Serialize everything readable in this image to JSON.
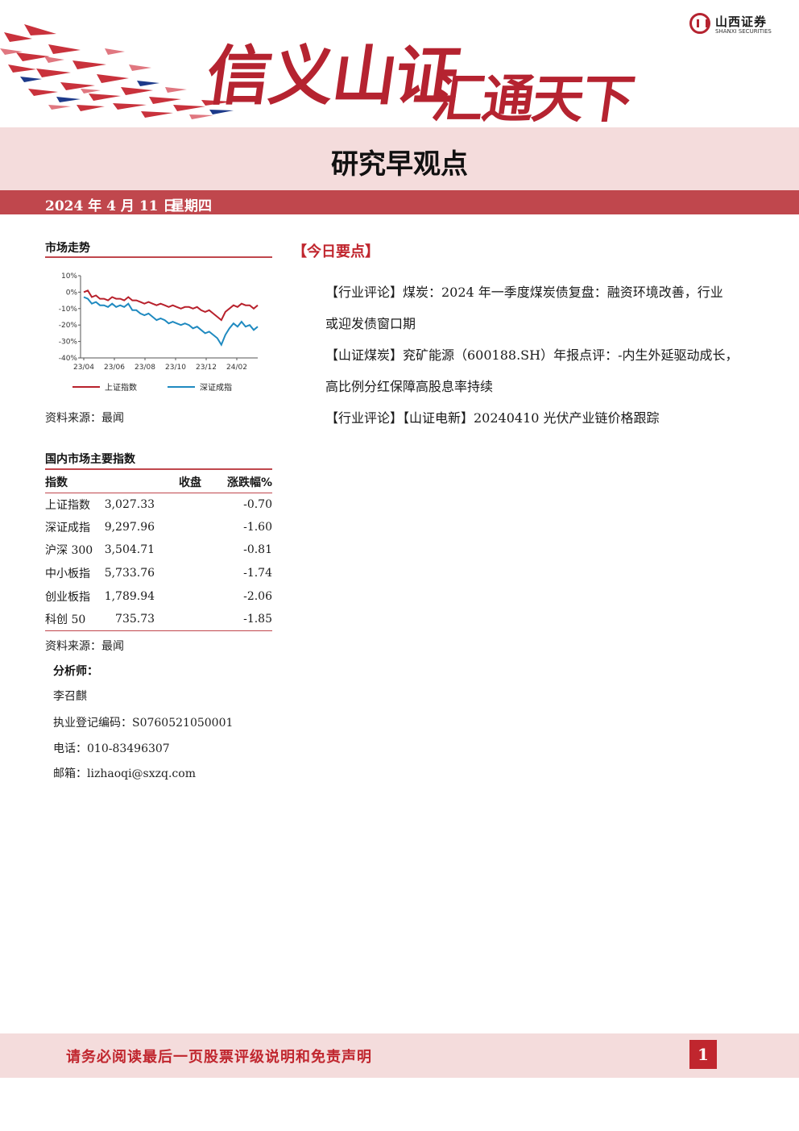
{
  "header": {
    "slogan_part1": "信义山证",
    "slogan_part2": "汇通天下",
    "logo_cn": "山西证券",
    "logo_en": "SHANXI SECURITIES",
    "brand_color": "#b52330"
  },
  "title": "研究早观点",
  "date": {
    "date_text": "2024 年 4 月 11 日",
    "weekday": "星期四"
  },
  "market_trend": {
    "section_title": "市场走势",
    "source": "资料来源：最闻"
  },
  "chart_data": {
    "type": "line",
    "x": [
      "23/04",
      "23/06",
      "23/08",
      "23/10",
      "23/12",
      "24/02"
    ],
    "ylim": [
      -40,
      10
    ],
    "y_ticks": [
      "10%",
      "0%",
      "-10%",
      "-20%",
      "-30%",
      "-40%"
    ],
    "legend_position": "bottom",
    "series": [
      {
        "name": "上证指数",
        "color": "#b8212c",
        "values": [
          0,
          1,
          -3,
          -2,
          -4,
          -4,
          -5,
          -3,
          -4,
          -4,
          -5,
          -3,
          -5,
          -5,
          -6,
          -7,
          -6,
          -7,
          -8,
          -7,
          -8,
          -9,
          -8,
          -9,
          -10,
          -9,
          -9,
          -10,
          -9,
          -11,
          -12,
          -11,
          -13,
          -15,
          -17,
          -12,
          -10,
          -8,
          -9,
          -7,
          -8,
          -8,
          -10,
          -8
        ]
      },
      {
        "name": "深证成指",
        "color": "#1f8ac0",
        "values": [
          -3,
          -4,
          -7,
          -6,
          -8,
          -8,
          -9,
          -7,
          -9,
          -8,
          -9,
          -7,
          -11,
          -11,
          -13,
          -14,
          -13,
          -15,
          -17,
          -16,
          -17,
          -19,
          -18,
          -19,
          -20,
          -19,
          -20,
          -22,
          -21,
          -23,
          -25,
          -24,
          -26,
          -28,
          -32,
          -26,
          -22,
          -19,
          -21,
          -18,
          -21,
          -20,
          -23,
          -21
        ]
      }
    ]
  },
  "index_table": {
    "section_title": "国内市场主要指数",
    "headers": [
      "指数",
      "收盘",
      "涨跌幅%"
    ],
    "rows": [
      [
        "上证指数",
        "3,027.33",
        "-0.70"
      ],
      [
        "深证成指",
        "9,297.96",
        "-1.60"
      ],
      [
        "沪深 300",
        "3,504.71",
        "-0.81"
      ],
      [
        "中小板指",
        "5,733.76",
        "-1.74"
      ],
      [
        "创业板指",
        "1,789.94",
        "-2.06"
      ],
      [
        "科创 50",
        "735.73",
        "-1.85"
      ]
    ],
    "source": "资料来源：最闻"
  },
  "analyst": {
    "label": "分析师：",
    "name": "李召麒",
    "license": "执业登记编码：S0760521050001",
    "phone": "电话：010-83496307",
    "email": "邮箱：lizhaoqi@sxzq.com"
  },
  "key_points": {
    "title": "【今日要点】",
    "lines": [
      "【行业评论】煤炭：2024 年一季度煤炭债复盘：融资环境改善，行业",
      "或迎发债窗口期",
      "【山证煤炭】兖矿能源（600188.SH）年报点评：-内生外延驱动成长，",
      "高比例分红保障高股息率持续",
      "【行业评论】【山证电新】20240410 光伏产业链价格跟踪"
    ]
  },
  "footer": {
    "note": "请务必阅读最后一页股票评级说明和免责声明",
    "page": "1"
  }
}
